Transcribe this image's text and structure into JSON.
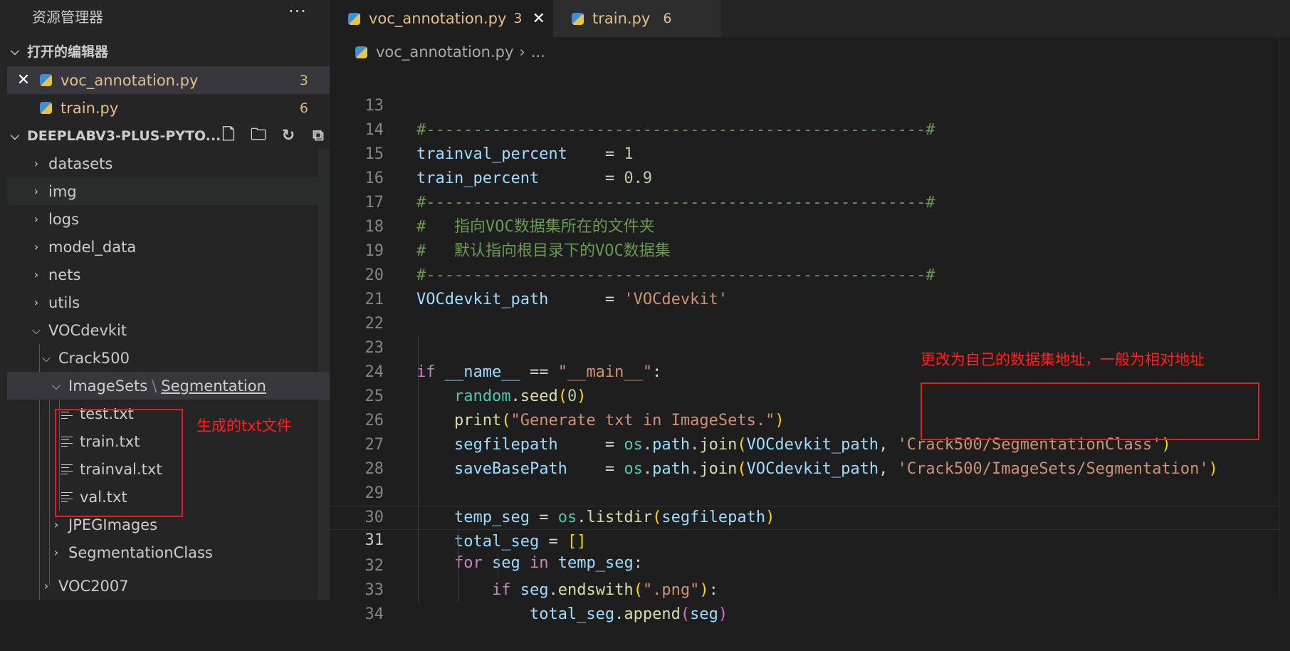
{
  "sidebar": {
    "title": "资源管理器",
    "more": "···",
    "open_editors": {
      "label": "打开的编辑器",
      "files": [
        {
          "name": "voc_annotation.py",
          "badge": "3"
        },
        {
          "name": "train.py",
          "badge": "6"
        }
      ]
    },
    "project": {
      "label": "DEEPLABV3-PLUS-PYTO...",
      "tree": [
        "datasets",
        "img",
        "logs",
        "model_data",
        "nets",
        "utils",
        "VOCdevkit",
        "Crack500",
        "ImageSets",
        "Segmentation",
        "test.txt",
        "train.txt",
        "trainval.txt",
        "val.txt",
        "JPEGImages",
        "SegmentationClass",
        "VOC2007"
      ]
    }
  },
  "tabs": [
    {
      "name": "voc_annotation.py",
      "badge": "3",
      "close": "✕"
    },
    {
      "name": "train.py",
      "badge": "6"
    }
  ],
  "breadcrumb": {
    "file": "voc_annotation.py",
    "sep": "›",
    "rest": "..."
  },
  "line_numbers": [
    "13",
    "14",
    "15",
    "16",
    "17",
    "18",
    "19",
    "20",
    "21",
    "22",
    "23",
    "24",
    "25",
    "26",
    "27",
    "28",
    "29",
    "30",
    "31",
    "32",
    "33",
    "34"
  ],
  "code": {
    "l13": "#-----------------------------------------------------#",
    "l14_var": "trainval_percent",
    "l14_eq": "    = ",
    "l14_val": "1",
    "l15_var": "train_percent",
    "l15_eq": "       = ",
    "l15_val": "0.9",
    "l16": "#-----------------------------------------------------#",
    "l17": "#   指向VOC数据集所在的文件夹",
    "l18": "#   默认指向根目录下的VOC数据集",
    "l19": "#-----------------------------------------------------#",
    "l20_var": "VOCdevkit_path",
    "l20_eq": "      = ",
    "l20_val": "'VOCdevkit'",
    "l23_kw": "if",
    "l23_name": "__name__",
    "l23_op": " == ",
    "l23_str": "\"__main__\"",
    "l23_end": ":",
    "l24_mod": "random",
    "l24_fn": "seed",
    "l24_arg": "0",
    "l25_fn": "print",
    "l25_str": "\"Generate txt in ImageSets.\"",
    "l26_var": "segfilepath",
    "l26_eq": "     = ",
    "l26_mod": "os",
    "l26_path": "path",
    "l26_fn": "join",
    "l26_arg": "VOCdevkit_path",
    "l26_str": "'Crack500/SegmentationClass'",
    "l27_var": "saveBasePath",
    "l27_eq": "    = ",
    "l27_mod": "os",
    "l27_path": "path",
    "l27_fn": "join",
    "l27_arg": "VOCdevkit_path",
    "l27_str": "'Crack500/ImageSets/Segmentation'",
    "l29_var": "temp_seg",
    "l29_mod": "os",
    "l29_fn": "listdir",
    "l29_arg": "segfilepath",
    "l30_var": "total_seg",
    "l31_kw": "for",
    "l31_var": "seg",
    "l31_in": "in",
    "l31_iter": "temp_seg",
    "l32_kw": "if",
    "l32_var": "seg",
    "l32_fn": "endswith",
    "l32_str": "\".png\"",
    "l33_var": "total_seg",
    "l33_fn": "append",
    "l33_arg": "seg"
  },
  "annotations": {
    "txt_files": "生成的txt文件",
    "path_note": "更改为自己的数据集地址，一般为相对地址"
  },
  "colors": {
    "annotation_red": "#e02020",
    "comment_green": "#6a9955",
    "string_orange": "#ce9178"
  }
}
